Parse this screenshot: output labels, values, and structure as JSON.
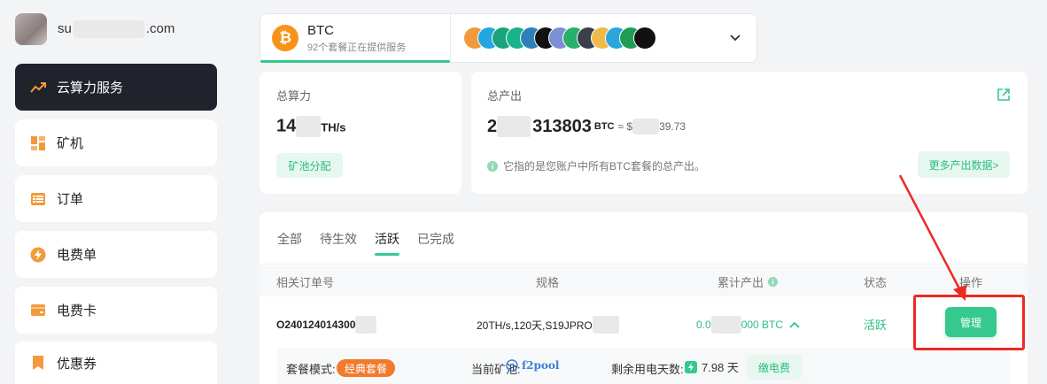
{
  "user": {
    "email_prefix": "su",
    "email_suffix": ".com"
  },
  "sidebar": {
    "items": [
      {
        "label": "云算力服务",
        "icon": "trending-up-icon",
        "active": true
      },
      {
        "label": "矿机",
        "icon": "miner-icon"
      },
      {
        "label": "订单",
        "icon": "list-icon"
      },
      {
        "label": "电费单",
        "icon": "lightning-icon"
      },
      {
        "label": "电费卡",
        "icon": "card-icon"
      },
      {
        "label": "优惠券",
        "icon": "bookmark-icon"
      }
    ]
  },
  "coin": {
    "name": "BTC",
    "desc": "92个套餐正在提供服务",
    "logo_glyph": "₿",
    "other_coin_colors": [
      "#f29a3b",
      "#23a7e0",
      "#1ba37c",
      "#18b38b",
      "#2f7fb9",
      "#111111",
      "#7c8fd6",
      "#27b06a",
      "#3b3f4a",
      "#f0b94a",
      "#2aa6d9",
      "#1f9d55",
      "#111111"
    ]
  },
  "hashrate": {
    "label": "总算力",
    "value_prefix": "14",
    "unit": "TH/s",
    "pool_btn": "矿池分配"
  },
  "output": {
    "label": "总产出",
    "value_prefix": "2",
    "value_main": "313803",
    "unit": "BTC",
    "approx": "≈ $",
    "fiat_suffix": "39.73",
    "note": "它指的是您账户中所有BTC套餐的总产出。",
    "more_btn": "更多产出数据>"
  },
  "orders": {
    "tabs": [
      {
        "label": "全部"
      },
      {
        "label": "待生效"
      },
      {
        "label": "活跃",
        "active": true
      },
      {
        "label": "已完成"
      }
    ],
    "headers": {
      "order_no": "相关订单号",
      "spec": "规格",
      "output": "累计产出",
      "status": "状态",
      "action": "操作"
    },
    "row": {
      "order_no": "O240124014300",
      "spec": "20TH/s,120天,S19JPRO",
      "output_prefix": "0.0",
      "output_suffix": "000 BTC",
      "status": "活跃",
      "manage": "管理"
    },
    "detail": {
      "plan_label": "套餐模式:",
      "plan_value": "经典套餐",
      "pool_label": "当前矿池:",
      "pool_value": "f2pool",
      "days_label": "剩余用电天数:",
      "days_value": "7.98 天",
      "pay_btn": "缴电费"
    }
  },
  "colors": {
    "accent": "#36c98f",
    "dark": "#20232c",
    "btc": "#f7931a",
    "annotation": "#ee2a24"
  }
}
